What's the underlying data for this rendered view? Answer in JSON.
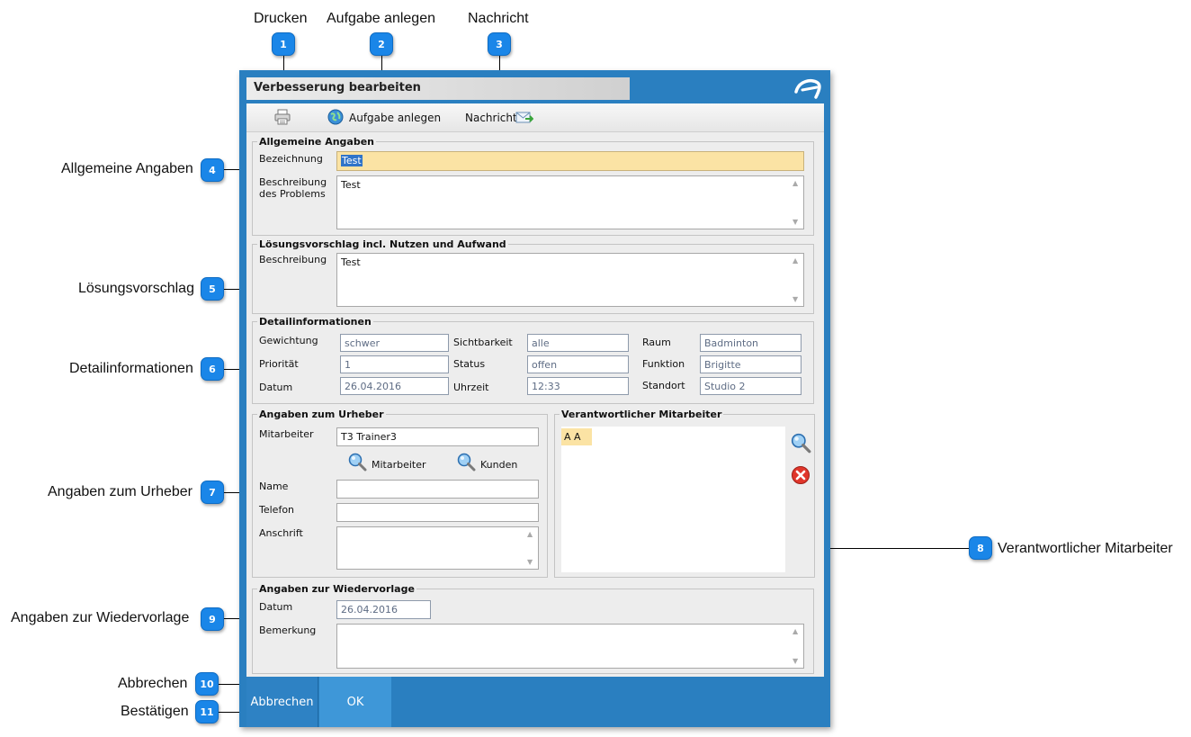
{
  "annotations": {
    "top": [
      {
        "label": "Drucken",
        "num": "1"
      },
      {
        "label": "Aufgabe anlegen",
        "num": "2"
      },
      {
        "label": "Nachricht",
        "num": "3"
      }
    ],
    "left": [
      {
        "label": "Allgemeine Angaben",
        "num": "4"
      },
      {
        "label": "Lösungsvorschlag",
        "num": "5"
      },
      {
        "label": "Detailinformationen",
        "num": "6"
      },
      {
        "label": "Angaben zum Urheber",
        "num": "7"
      },
      {
        "label": "Angaben zur Wiedervorlage",
        "num": "9"
      },
      {
        "label": "Abbrechen",
        "num": "10"
      },
      {
        "label": "Bestätigen",
        "num": "11"
      }
    ],
    "right": {
      "label": "Verantwortlicher Mitarbeiter",
      "num": "8"
    }
  },
  "dialog": {
    "title": "Verbesserung bearbeiten",
    "toolbar": {
      "task_label": "Aufgabe anlegen",
      "message_label": "Nachricht"
    },
    "general": {
      "title": "Allgemeine Angaben",
      "name_label": "Bezeichnung",
      "name_value": "Test",
      "desc_label_1": "Beschreibung",
      "desc_label_2": "des Problems",
      "desc_value": "Test"
    },
    "solution": {
      "title": "Lösungsvorschlag incl. Nutzen und Aufwand",
      "desc_label": "Beschreibung",
      "desc_value": "Test"
    },
    "details": {
      "title": "Detailinformationen",
      "weight_label": "Gewichtung",
      "weight_value": "schwer",
      "priority_label": "Priorität",
      "priority_value": "1",
      "date_label": "Datum",
      "date_value": "26.04.2016",
      "visibility_label": "Sichtbarkeit",
      "visibility_value": "alle",
      "status_label": "Status",
      "status_value": "offen",
      "time_label": "Uhrzeit",
      "time_value": "12:33",
      "room_label": "Raum",
      "room_value": "Badminton",
      "function_label": "Funktion",
      "function_value": "Brigitte",
      "location_label": "Standort",
      "location_value": "Studio 2"
    },
    "originator": {
      "title": "Angaben zum Urheber",
      "employee_label": "Mitarbeiter",
      "employee_value": "T3 Trainer3",
      "search_employee_label": "Mitarbeiter",
      "search_customer_label": "Kunden",
      "name_label": "Name",
      "name_value": "",
      "phone_label": "Telefon",
      "phone_value": "",
      "address_label": "Anschrift",
      "address_value": ""
    },
    "responsible": {
      "title": "Verantwortlicher Mitarbeiter",
      "items": [
        "A A"
      ]
    },
    "followup": {
      "title": "Angaben zur Wiedervorlage",
      "date_label": "Datum",
      "date_value": "26.04.2016",
      "remark_label": "Bemerkung",
      "remark_value": ""
    },
    "footer": {
      "cancel_label": "Abbrechen",
      "ok_label": "OK"
    }
  }
}
